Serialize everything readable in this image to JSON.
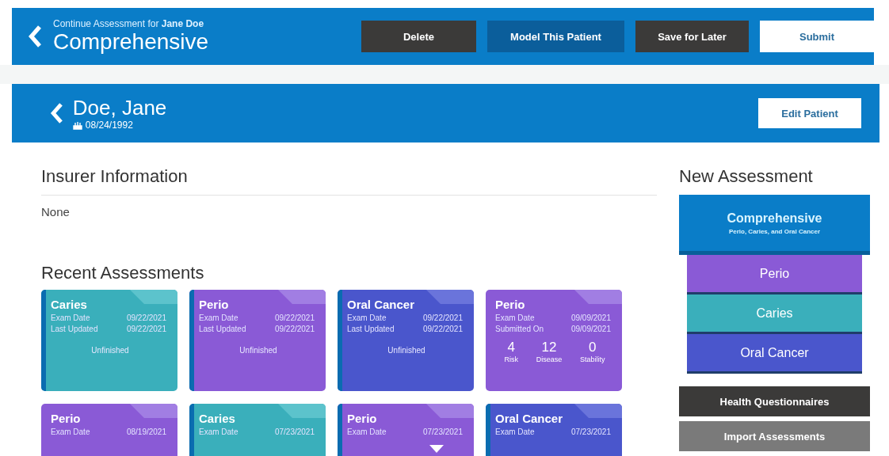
{
  "header": {
    "subtitle": "Continue Assessment for **Jane Doe**",
    "title": "Comprehensive",
    "buttons": [
      {
        "label": "Delete",
        "kind": "dark"
      },
      {
        "label": "Model This Patient",
        "kind": "blue"
      },
      {
        "label": "Save for Later",
        "kind": "dark"
      },
      {
        "label": "Submit",
        "kind": "light"
      }
    ]
  },
  "patient": {
    "name": "Doe, Jane",
    "birth_date": "08/24/1992",
    "edit_button": "Edit Patient"
  },
  "insurer": {
    "heading": "Insurer Information",
    "value": "None"
  },
  "recent": {
    "heading": "Recent Assessments",
    "cards": [
      {
        "kind": "caries",
        "title": "Caries",
        "flagged": true,
        "rows": [
          [
            "Exam Date",
            "09/22/2021"
          ],
          [
            "Last Updated",
            "09/22/2021"
          ]
        ],
        "status": "Unfinished"
      },
      {
        "kind": "perio",
        "title": "Perio",
        "flagged": true,
        "rows": [
          [
            "Exam Date",
            "09/22/2021"
          ],
          [
            "Last Updated",
            "09/22/2021"
          ]
        ],
        "status": "Unfinished"
      },
      {
        "kind": "oral_cancer",
        "title": "Oral Cancer",
        "flagged": true,
        "rows": [
          [
            "Exam Date",
            "09/22/2021"
          ],
          [
            "Last Updated",
            "09/22/2021"
          ]
        ],
        "status": "Unfinished"
      },
      {
        "kind": "perio",
        "title": "Perio",
        "flagged": false,
        "rows": [
          [
            "Exam Date",
            "09/09/2021"
          ],
          [
            "Submitted On",
            "09/09/2021"
          ]
        ],
        "scores": [
          {
            "value": "4",
            "label": "Risk"
          },
          {
            "value": "12",
            "label": "Disease"
          },
          {
            "value": "0",
            "label": "Stability"
          }
        ]
      },
      {
        "kind": "perio",
        "title": "Perio",
        "flagged": false,
        "rows": [
          [
            "Exam Date",
            "08/19/2021"
          ]
        ]
      },
      {
        "kind": "caries",
        "title": "Caries",
        "flagged": true,
        "rows": [
          [
            "Exam Date",
            "07/23/2021"
          ]
        ]
      },
      {
        "kind": "perio",
        "title": "Perio",
        "flagged": true,
        "caret": true,
        "rows": [
          [
            "Exam Date",
            "07/23/2021"
          ]
        ]
      },
      {
        "kind": "oral_cancer",
        "title": "Oral Cancer",
        "flagged": true,
        "rows": [
          [
            "Exam Date",
            "07/23/2021"
          ]
        ]
      }
    ]
  },
  "new_assessment": {
    "heading": "New Assessment",
    "primary": {
      "title": "Comprehensive",
      "subtitle": "Perio, Caries, and Oral Cancer"
    },
    "options": [
      {
        "kind": "perio",
        "label": "Perio"
      },
      {
        "kind": "caries",
        "label": "Caries"
      },
      {
        "kind": "oral_cancer",
        "label": "Oral Cancer"
      }
    ],
    "actions": [
      {
        "kind": "dark",
        "label": "Health Questionnaires"
      },
      {
        "kind": "gray",
        "label": "Import Assessments"
      }
    ]
  }
}
